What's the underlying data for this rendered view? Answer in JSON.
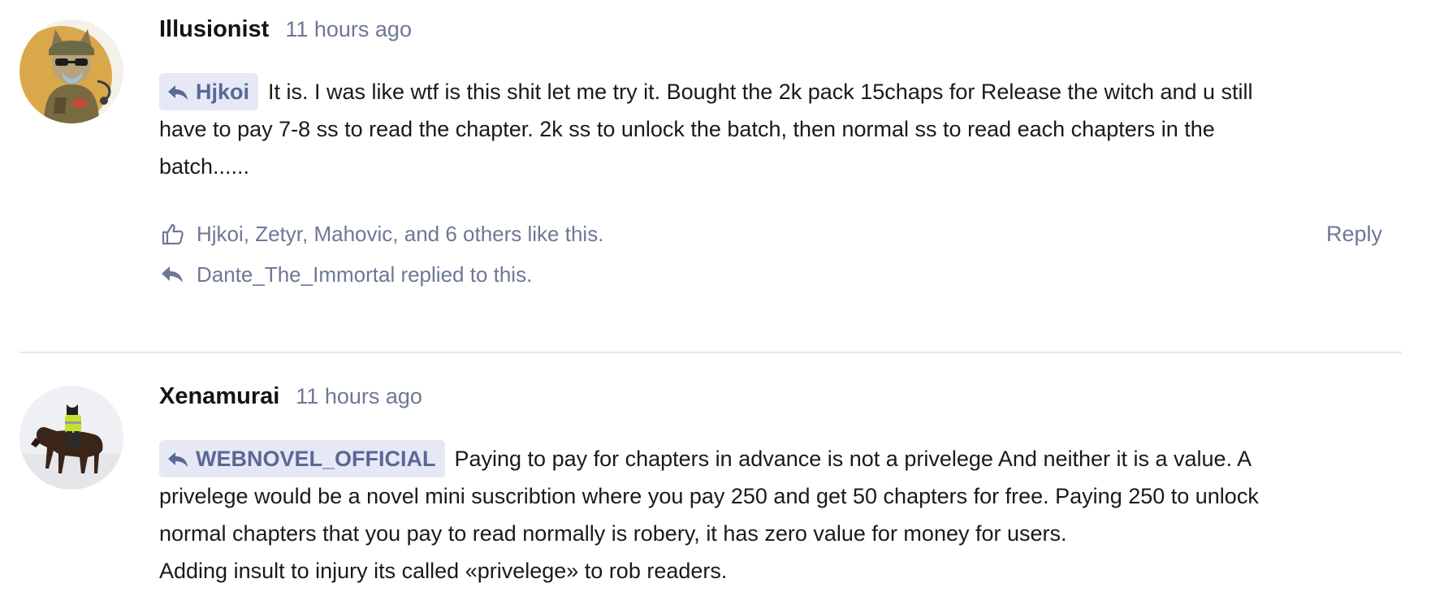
{
  "comments": [
    {
      "username": "Illusionist",
      "time": "11 hours ago",
      "reply_to": "Hjkoi",
      "text_lines": [
        "It is. I was like wtf is this shit let me try it. Bought the 2k pack 15chaps for Release the witch and u still",
        "have to pay 7-8 ss to read the chapter. 2k ss to unlock the batch, then normal ss to read each chapters in the",
        "batch......"
      ],
      "likes_text": "Hjkoi, Zetyr, Mahovic, and 6 others like this.",
      "replies_text": "Dante_The_Immortal replied to this.",
      "reply_label": "Reply",
      "avatar_icon": "soldier-cat-avatar"
    },
    {
      "username": "Xenamurai",
      "time": "11 hours ago",
      "reply_to": "WEBNOVEL_OFFICIAL",
      "text_lines": [
        "Paying to pay for chapters in advance is not a privelege And neither it is a value. A",
        "privelege would be a novel mini suscribtion where you pay 250 and get 50 chapters for free. Paying 250 to unlock",
        "normal chapters that you pay to read normally is robery, it has zero value for money for users.",
        "Adding insult to injury its called «privelege» to rob readers."
      ],
      "avatar_icon": "horse-rider-avatar"
    }
  ],
  "colors": {
    "muted": "#6e7896",
    "mention_bg": "#e6e9f5",
    "mention_text": "#5a6896",
    "divider": "#e6e8ee"
  }
}
